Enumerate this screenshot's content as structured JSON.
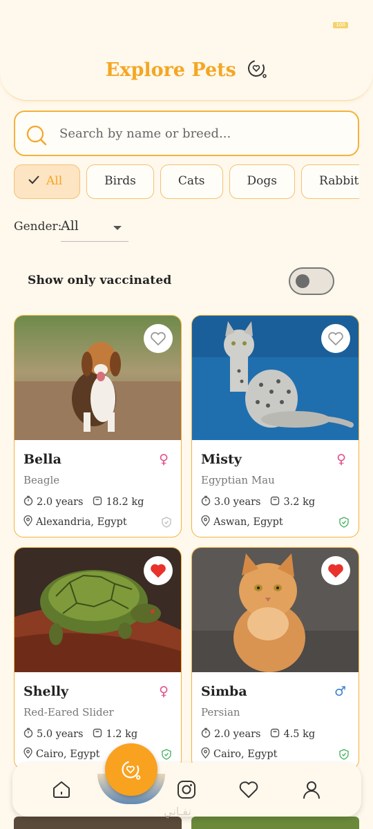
{
  "status": {
    "battery": "100"
  },
  "header": {
    "title": "Explore Pets"
  },
  "search": {
    "placeholder": "Search by name or breed..."
  },
  "filters": {
    "categories": [
      "All",
      "Birds",
      "Cats",
      "Dogs",
      "Rabbit"
    ],
    "selected": "All",
    "gender_label": "Gender:",
    "gender_value": "All",
    "vaccinated_label": "Show only vaccinated",
    "vaccinated_on": false
  },
  "pets": [
    {
      "name": "Bella",
      "breed": "Beagle",
      "age": "2.0 years",
      "weight": "18.2 kg",
      "location": "Alexandria, Egypt",
      "sex": "female",
      "sex_symbol": "♀",
      "favorite": false,
      "vaccinated": false
    },
    {
      "name": "Misty",
      "breed": "Egyptian Mau",
      "age": "3.0 years",
      "weight": "3.2 kg",
      "location": "Aswan, Egypt",
      "sex": "female",
      "sex_symbol": "♀",
      "favorite": false,
      "vaccinated": true
    },
    {
      "name": "Shelly",
      "breed": "Red-Eared Slider",
      "age": "5.0 years",
      "weight": "1.2 kg",
      "location": "Cairo, Egypt",
      "sex": "female",
      "sex_symbol": "♀",
      "favorite": true,
      "vaccinated": true
    },
    {
      "name": "Simba",
      "breed": "Persian",
      "age": "2.0 years",
      "weight": "4.5 kg",
      "location": "Cairo, Egypt",
      "sex": "male",
      "sex_symbol": "♂",
      "favorite": true,
      "vaccinated": true
    }
  ],
  "nav": {
    "items": [
      "home-icon",
      "paw-logo-icon",
      "instagram-icon",
      "heart-icon",
      "profile-icon"
    ]
  },
  "colors": {
    "accent": "#f4a623",
    "female": "#e0508a",
    "male": "#3d7fd1",
    "fav_red": "#e8322b",
    "vaccinated_green": "#3fae5a"
  },
  "watermark": "نفـاني"
}
